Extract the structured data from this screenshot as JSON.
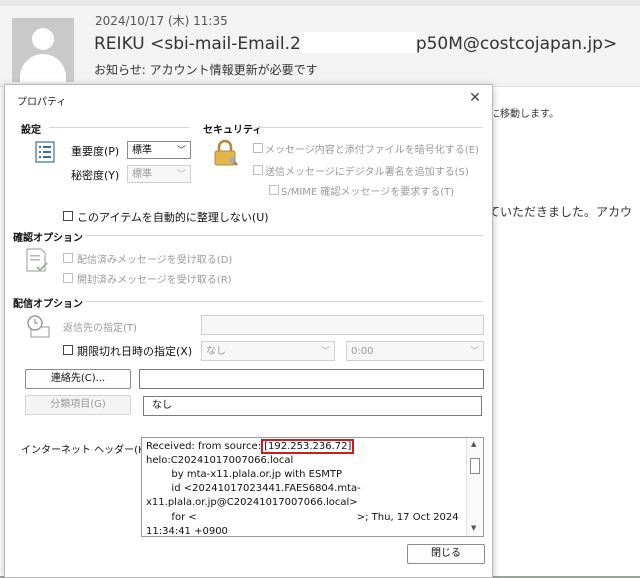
{
  "background": {
    "date": "2024/10/17 (木) 11:35",
    "from_prefix": "REIKU <sbi-mail-Email.2",
    "from_suffix": "p50M@costcojapan.jp>",
    "subject": "お知らせ: アカウント情報更新が必要です",
    "notice_fragment": "に移動します。",
    "body_fragment": "ていただきました。アカウ"
  },
  "dialog": {
    "title": "プロパティ",
    "close_glyph": "✕",
    "settings": {
      "heading": "設定",
      "importance_label": "重要度(P)",
      "importance_value": "標準",
      "sensitivity_label": "秘密度(Y)",
      "sensitivity_value": "標準",
      "auto_archive_label": "このアイテムを自動的に整理しない(U)"
    },
    "security": {
      "heading": "セキュリティ",
      "encrypt_label": "メッセージ内容と添付ファイルを暗号化する(E)",
      "signature_label": "送信メッセージにデジタル署名を追加する(S)",
      "smime_label": "S/MIME 確認メッセージを要求する(T)"
    },
    "tracking": {
      "heading": "確認オプション",
      "delivery_receipt_label": "配信済みメッセージを受け取る(D)",
      "read_receipt_label": "開封済みメッセージを受け取る(R)"
    },
    "delivery": {
      "heading": "配信オプション",
      "reply_to_label": "返信先の指定(T)",
      "expires_label": "期限切れ日時の指定(X)",
      "expires_date": "なし",
      "expires_time": "0:00"
    },
    "contacts_button": "連絡先(C)...",
    "categories_button": "分類項目(G)",
    "categories_value": "なし",
    "internet_headers_label": "インターネット ヘッダー(H)",
    "headers": {
      "line1_prefix": "Received: from source:",
      "line1_ip": "[192.253.236.72]",
      "line2": "helo:C20241017007066.local",
      "line3": "        by mta-x11.plala.or.jp with ESMTP",
      "line4": "        id <20241017023441.FAES6804.mta-",
      "line5": "x11.plala.or.jp@C20241017007066.local>",
      "line6_prefix": "        for <",
      "line6_suffix": ">; Thu, 17 Oct 2024",
      "line7": "11:34:41 +0900"
    },
    "close_button": "閉じる"
  }
}
